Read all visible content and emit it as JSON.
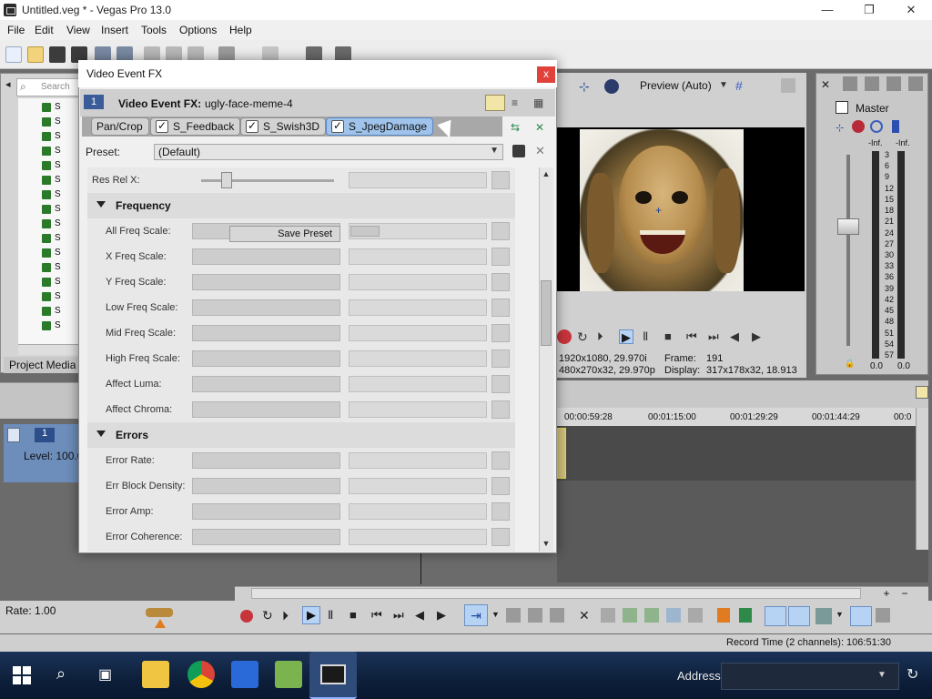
{
  "window": {
    "title": "Untitled.veg * - Vegas Pro 13.0"
  },
  "menu": [
    "File",
    "Edit",
    "View",
    "Insert",
    "Tools",
    "Options",
    "Help"
  ],
  "media": {
    "search_placeholder": "Search",
    "tab_label": "Project Media"
  },
  "preview": {
    "quality_label": "Preview (Auto)",
    "project_info": "1920x1080, 29.970i",
    "preview_info": "480x270x32, 29.970p",
    "frame_label": "Frame:",
    "frame_value": "191",
    "display_label": "Display:",
    "display_value": "317x178x32, 18.913"
  },
  "master": {
    "label": "Master",
    "db_l": "-Inf.",
    "db_r": "-Inf.",
    "bottom_l": "0.0",
    "bottom_r": "0.0",
    "ticks": [
      "3",
      "6",
      "9",
      "12",
      "15",
      "18",
      "21",
      "24",
      "27",
      "30",
      "33",
      "36",
      "39",
      "42",
      "45",
      "48",
      "51",
      "54",
      "57"
    ]
  },
  "timeline": {
    "markers": [
      "00:00:59:28",
      "00:01:15:00",
      "00:01:29:29",
      "00:01:44:29",
      "00:0"
    ],
    "track_number": "1",
    "track_level": "Level: 100.0"
  },
  "bottom": {
    "rate": "Rate: 1.00",
    "record_time": "Record Time (2 channels): 106:51:30"
  },
  "taskbar": {
    "address_label": "Address"
  },
  "dialog": {
    "title": "Video Event FX",
    "close_label": "x",
    "fx_number": "1",
    "fx_label": "Video Event FX:",
    "fx_name": "ugly-face-meme-4",
    "chain": [
      "Pan/Crop",
      "S_Feedback",
      "S_Swish3D",
      "S_JpegDamage"
    ],
    "preset_label": "Preset:",
    "preset_value": "(Default)",
    "save_preset_label": "Save Preset",
    "rows_top": [
      "Res Rel X:"
    ],
    "section_frequency": "Frequency",
    "frequency_rows": [
      "All Freq Scale:",
      "X Freq Scale:",
      "Y Freq Scale:",
      "Low Freq Scale:",
      "Mid Freq Scale:",
      "High Freq Scale:",
      "Affect Luma:",
      "Affect Chroma:"
    ],
    "section_errors": "Errors",
    "error_rows": [
      "Error Rate:",
      "Err Block Density:",
      "Error Amp:",
      "Error Coherence:"
    ]
  }
}
